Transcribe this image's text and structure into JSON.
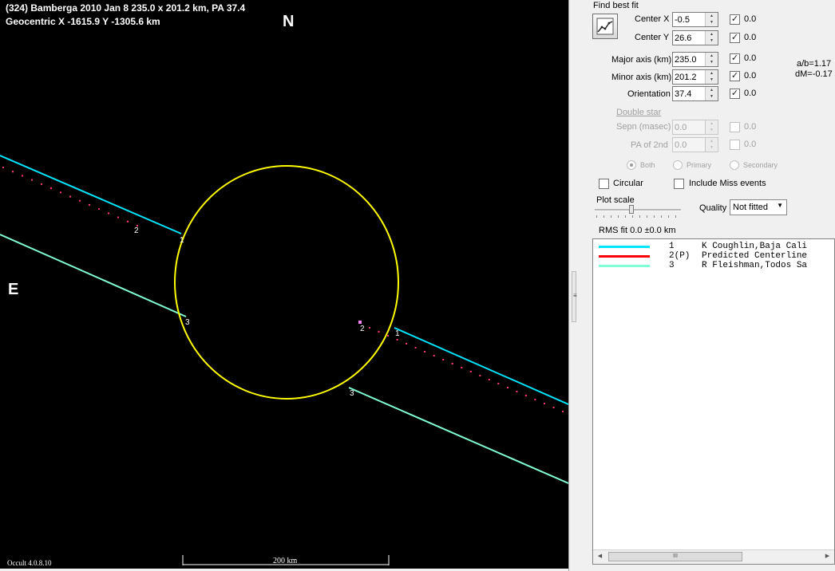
{
  "plot": {
    "title": "(324) Bamberga  2010 Jan 8  235.0 x 201.2 km,  PA 37.4",
    "geocentric": "Geocentric  X  -1615.9  Y  -1305.6 km",
    "north": "N",
    "east": "E",
    "version": "Occult 4.0.8.10",
    "scale_label": "200 km",
    "chord_labels": [
      "1",
      "2",
      "3",
      "1",
      "2",
      "3"
    ],
    "colors": {
      "background": "#000000",
      "ellipse": "#ffff00",
      "chord1": "#00e5ff",
      "chord3": "#7fffd4",
      "predicted": "#ff3a6e"
    }
  },
  "panel": {
    "find_best_fit": "Find best fit",
    "fields": [
      {
        "label": "Center X",
        "value": "-0.5",
        "checked": true,
        "fit": "0.0"
      },
      {
        "label": "Center Y",
        "value": "26.6",
        "checked": true,
        "fit": "0.0"
      },
      {
        "label": "Major axis (km)",
        "value": "235.0",
        "checked": true,
        "fit": "0.0"
      },
      {
        "label": "Minor axis (km)",
        "value": "201.2",
        "checked": true,
        "fit": "0.0"
      },
      {
        "label": "Orientation",
        "value": "37.4",
        "checked": true,
        "fit": "0.0"
      }
    ],
    "ab_ratio": "a/b=1.17",
    "dm": "dM=-0.17",
    "double_star": {
      "title": "Double star",
      "fields": [
        {
          "label": "Sepn (masec)",
          "value": "0.0",
          "fit": "0.0"
        },
        {
          "label": "PA of 2nd",
          "value": "0.0",
          "fit": "0.0"
        }
      ],
      "radios": [
        "Both",
        "Primary",
        "Secondary"
      ]
    },
    "circular": "Circular",
    "include_miss": "Include Miss events",
    "plot_scale": "Plot scale",
    "quality_label": "Quality",
    "quality_value": "Not fitted",
    "rms": "RMS fit 0.0 ±0.0 km",
    "legend": [
      {
        "num": "1",
        "name": "K Coughlin,Baja Cali",
        "color": "#00e5ff"
      },
      {
        "num": "2(P)",
        "name": "Predicted Centerline",
        "color": "#ff0000"
      },
      {
        "num": "3",
        "name": "R Fleishman,Todos Sa",
        "color": "#7fffd4"
      }
    ],
    "scroll_grip": "III"
  }
}
